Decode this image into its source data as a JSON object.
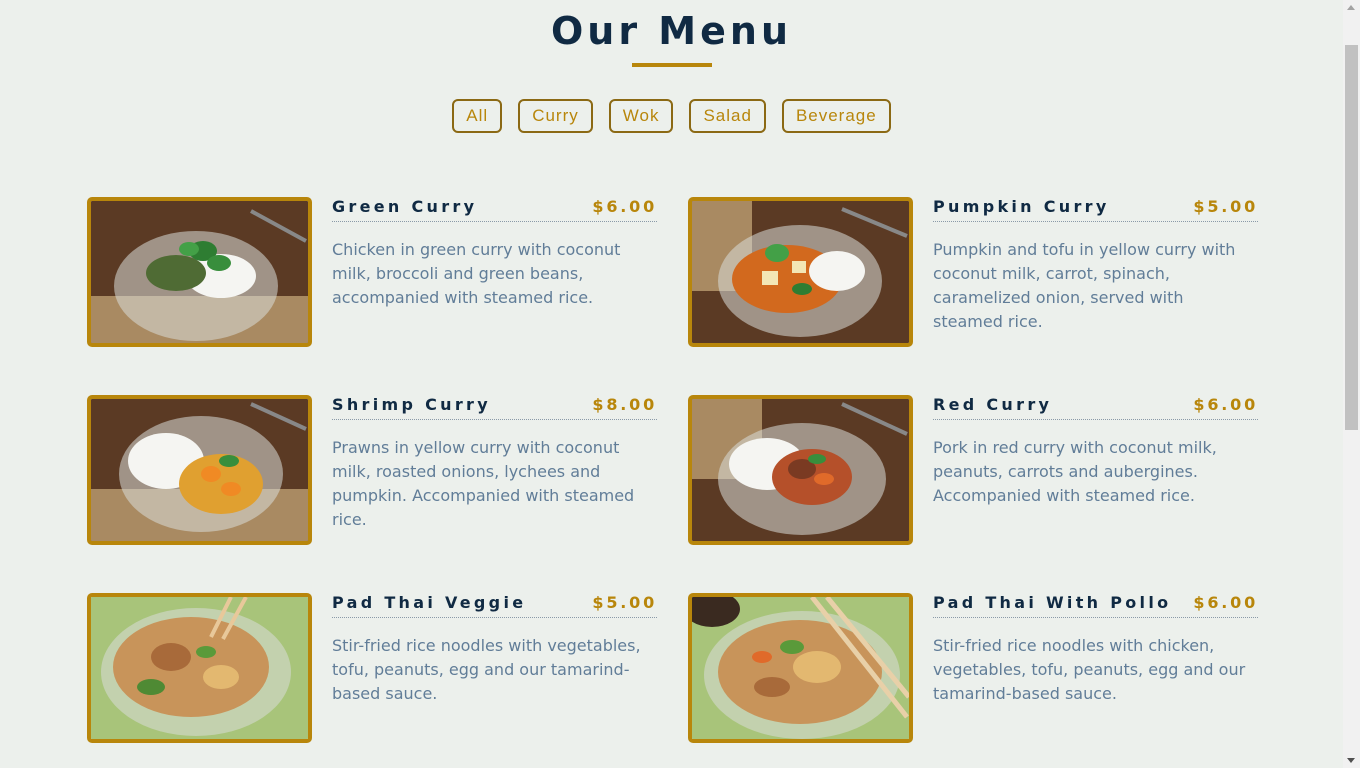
{
  "page": {
    "title": "Our Menu"
  },
  "filters": [
    "All",
    "Curry",
    "Wok",
    "Salad",
    "Beverage"
  ],
  "menu": {
    "items": [
      {
        "name": "Green Curry",
        "price": "$6.00",
        "description": "Chicken in green curry with coconut milk, broccoli and green beans, accompanied with steamed rice."
      },
      {
        "name": "Pumpkin Curry",
        "price": "$5.00",
        "description": "Pumpkin and tofu in yellow curry with coconut milk, carrot, spinach, caramelized onion, served with steamed rice."
      },
      {
        "name": "Shrimp Curry",
        "price": "$8.00",
        "description": "Prawns in yellow curry with coconut milk, roasted onions, lychees and pumpkin. Accompanied with steamed rice."
      },
      {
        "name": "Red Curry",
        "price": "$6.00",
        "description": "Pork in red curry with coconut milk, peanuts, carrots and aubergines. Accompanied with steamed rice."
      },
      {
        "name": "Pad Thai Veggie",
        "price": "$5.00",
        "description": "Stir-fried rice noodles with vegetables, tofu, peanuts, egg and our tamarind-based sauce."
      },
      {
        "name": "Pad Thai With Pollo",
        "price": "$6.00",
        "description": "Stir-fried rice noodles with chicken, vegetables, tofu, peanuts, egg and our tamarind-based sauce."
      }
    ]
  },
  "colors": {
    "background": "#ecf0ec",
    "title": "#102a43",
    "accent": "#b8860b",
    "text": "#617d98"
  }
}
